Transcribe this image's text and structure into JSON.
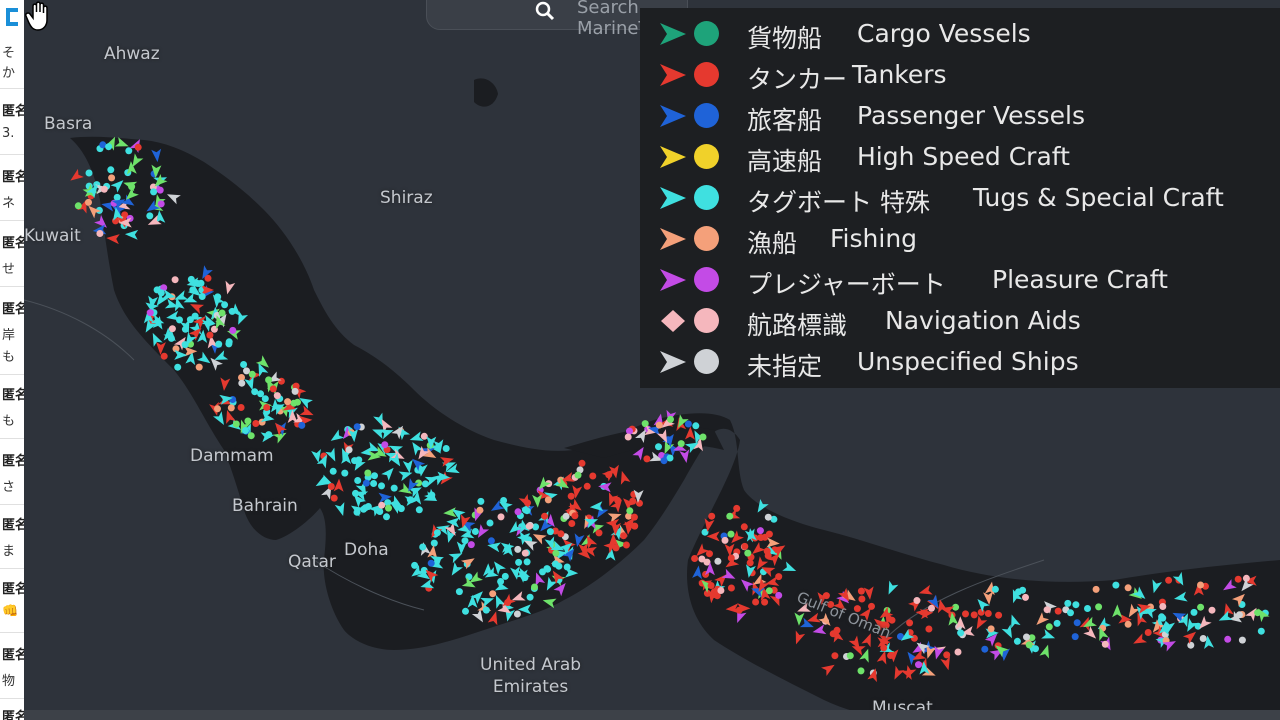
{
  "search": {
    "placeholder": "Search MarineTraffic"
  },
  "cities": {
    "ahwaz": "Ahwaz",
    "basra": "Basra",
    "shiraz": "Shiraz",
    "kuwait": "Kuwait",
    "dammam": "Dammam",
    "bahrain": "Bahrain",
    "qatar": "Qatar",
    "doha": "Doha",
    "uae_line1": "United Arab",
    "uae_line2": "Emirates",
    "gulf_of_oman": "Gulf of Oman",
    "muscat": "Muscat"
  },
  "legend": [
    {
      "jp": "貨物船",
      "en": "Cargo Vessels",
      "color": "#1ea37a",
      "shape": "arrow",
      "dot": "#1ea37a"
    },
    {
      "jp": "タンカー",
      "en": "Tankers",
      "color": "#e5392f",
      "shape": "arrow",
      "dot": "#e5392f"
    },
    {
      "jp": "旅客船",
      "en": "Passenger Vessels",
      "color": "#1f63d8",
      "shape": "arrow",
      "dot": "#1f63d8"
    },
    {
      "jp": "高速船",
      "en": "High Speed Craft",
      "color": "#f0d12a",
      "shape": "arrow",
      "dot": "#f0d12a"
    },
    {
      "jp": "タグボート 特殊",
      "en": "Tugs & Special Craft",
      "color": "#3fe0e0",
      "shape": "arrow",
      "dot": "#3fe0e0"
    },
    {
      "jp": "漁船",
      "en": "Fishing",
      "color": "#f4a07a",
      "shape": "arrow",
      "dot": "#f4a07a"
    },
    {
      "jp": "プレジャーボート",
      "en": "Pleasure Craft",
      "color": "#c34be6",
      "shape": "arrow",
      "dot": "#c34be6"
    },
    {
      "jp": "航路標識",
      "en": "Navigation Aids",
      "color": "#f5b7bd",
      "shape": "diamond",
      "dot": "#f5b7bd"
    },
    {
      "jp": "未指定",
      "en": "Unspecified Ships",
      "color": "#cfd2d6",
      "shape": "arrow",
      "dot": "#cfd2d6"
    }
  ],
  "sidebar_rows": [
    "そ",
    "か",
    "匿名",
    "3.",
    "匿名",
    "ネ",
    "匿名",
    "せ",
    "匿名",
    "岸",
    "も",
    "匿名",
    "も",
    "匿名",
    "さ",
    "匿名",
    "ま",
    "匿名",
    "👊",
    "匿名",
    "物",
    "匿名"
  ],
  "colors": {
    "water": "#1b1d21",
    "land": "#2e333b",
    "cargo": "#6ee26a",
    "tanker": "#e5392f",
    "tug": "#3fe0e0"
  }
}
